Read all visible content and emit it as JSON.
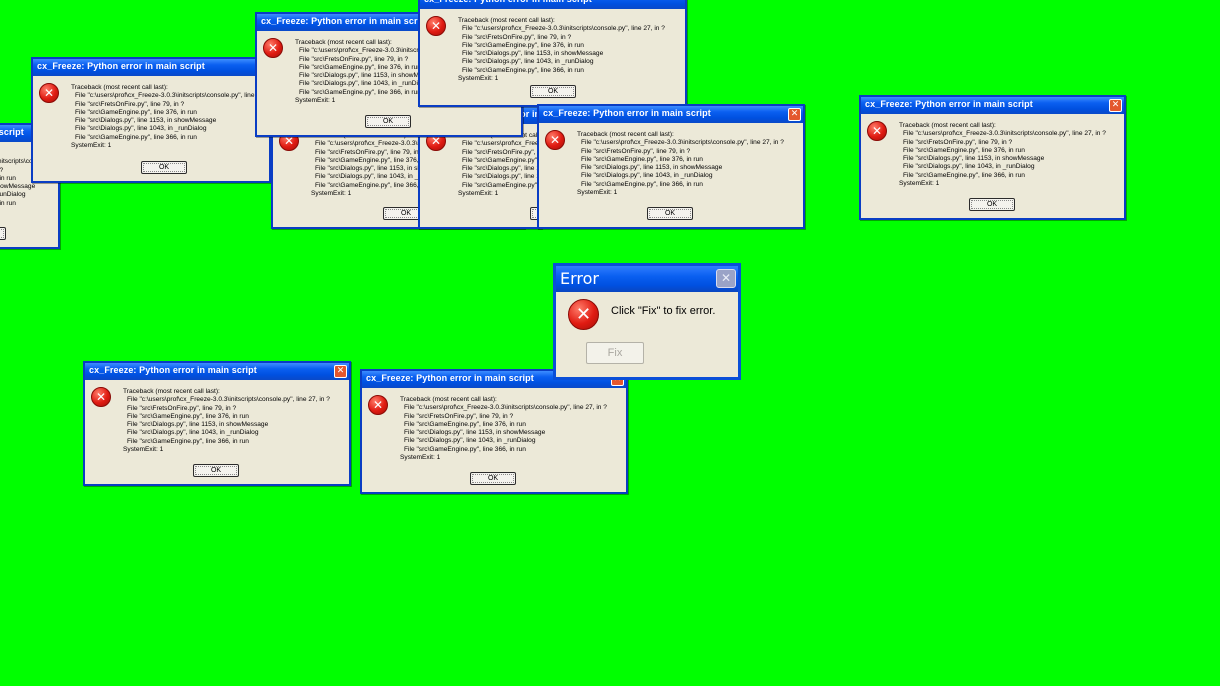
{
  "dialog": {
    "title": "cx_Freeze: Python error in main script",
    "close_label": "✕",
    "icon_glyph": "✕",
    "traceback": [
      "Traceback (most recent call last):",
      "File \"c:\\users\\prof\\cx_Freeze-3.0.3\\initscripts\\console.py\", line 27, in ?",
      "File \"src\\FretsOnFire.py\", line 79, in ?",
      "File \"src\\GameEngine.py\", line 376, in run",
      "File \"src\\Dialogs.py\", line 1153, in showMessage",
      "File \"src\\Dialogs.py\", line 1043, in _runDialog",
      "File \"src\\GameEngine.py\", line 366, in run",
      "SystemExit: 1"
    ],
    "ok_label": "OK"
  },
  "error_dialog": {
    "title": "Error",
    "close_label": "✕",
    "icon_glyph": "✕",
    "message": "Click \"Fix\" to fix error.",
    "fix_label": "Fix"
  },
  "colors": {
    "desktop": "#00ff00",
    "window_face": "#ece9d8",
    "title_blue": "#0a5ff0",
    "error_red": "#e01b12"
  }
}
